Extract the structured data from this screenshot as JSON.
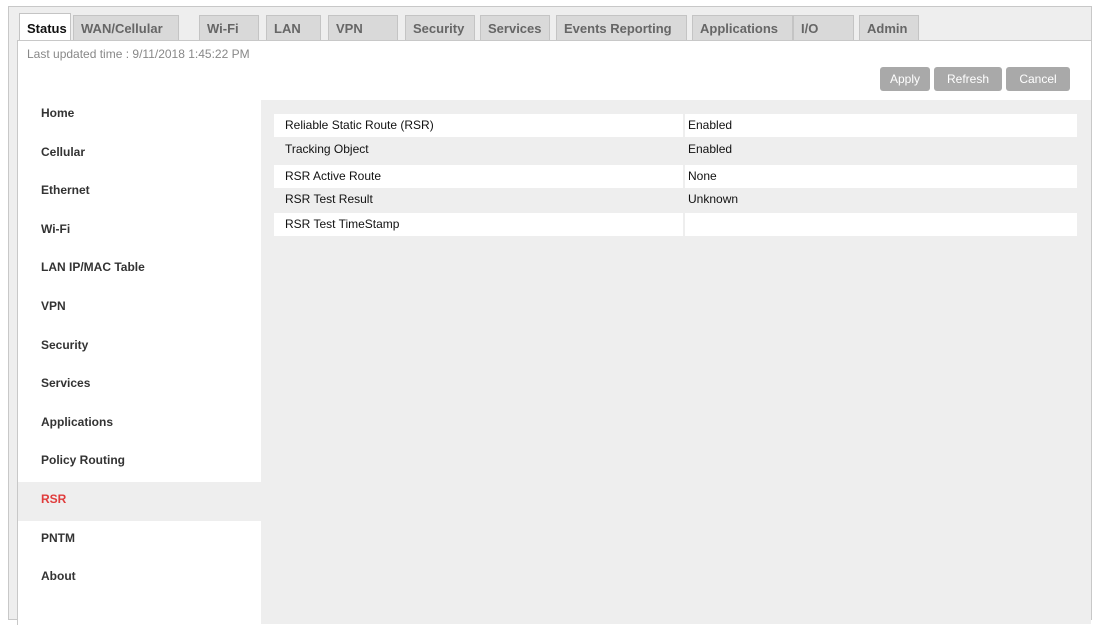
{
  "tabs": [
    {
      "label": "Status",
      "active": true
    },
    {
      "label": "WAN/Cellular",
      "active": false
    },
    {
      "label": "Wi-Fi",
      "active": false
    },
    {
      "label": "LAN",
      "active": false
    },
    {
      "label": "VPN",
      "active": false
    },
    {
      "label": "Security",
      "active": false
    },
    {
      "label": "Services",
      "active": false
    },
    {
      "label": "Events Reporting",
      "active": false
    },
    {
      "label": "Applications",
      "active": false
    },
    {
      "label": "I/O",
      "active": false
    },
    {
      "label": "Admin",
      "active": false
    }
  ],
  "header": {
    "last_updated": "Last updated time : 9/11/2018 1:45:22 PM",
    "apply_label": "Apply",
    "refresh_label": "Refresh",
    "cancel_label": "Cancel"
  },
  "sidebar": {
    "items": [
      {
        "label": "Home"
      },
      {
        "label": "Cellular"
      },
      {
        "label": "Ethernet"
      },
      {
        "label": "Wi-Fi"
      },
      {
        "label": "LAN IP/MAC Table"
      },
      {
        "label": "VPN"
      },
      {
        "label": "Security"
      },
      {
        "label": "Services"
      },
      {
        "label": "Applications"
      },
      {
        "label": "Policy Routing"
      },
      {
        "label": "RSR"
      },
      {
        "label": "PNTM"
      },
      {
        "label": "About"
      }
    ],
    "active_label": "RSR"
  },
  "status_table": [
    {
      "label": "Reliable Static Route (RSR)",
      "value": "Enabled"
    },
    {
      "label": "Tracking Object",
      "value": "Enabled"
    },
    {
      "label": "RSR Active Route",
      "value": "None"
    },
    {
      "label": "RSR Test Result",
      "value": "Unknown"
    },
    {
      "label": "RSR Test TimeStamp",
      "value": ""
    }
  ],
  "colors": {
    "active_sidebar_text": "#e03c3c",
    "button_bg": "#a9a9a9",
    "panel_bg": "#eeeeee"
  }
}
